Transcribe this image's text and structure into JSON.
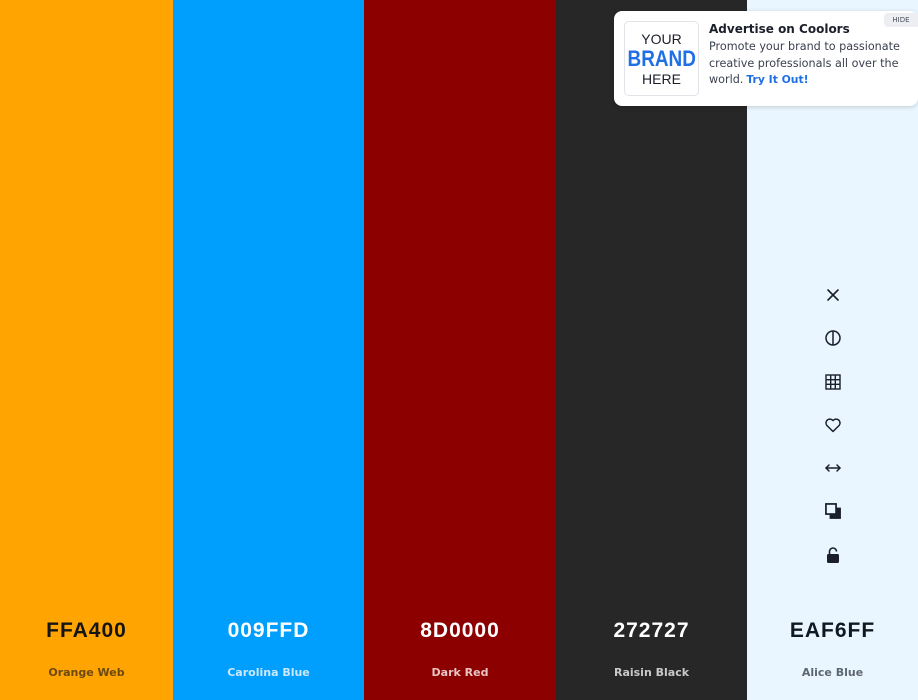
{
  "swatches": [
    {
      "hex": "FFA400",
      "name": "Orange Web",
      "bg": "#FFA400",
      "hex_color": "#151515",
      "name_color": "#6b4a12",
      "width": 173
    },
    {
      "hex": "009FFD",
      "name": "Carolina Blue",
      "bg": "#009FFD",
      "hex_color": "#ffffff",
      "name_color": "#cbe7fb",
      "width": 191
    },
    {
      "hex": "8D0000",
      "name": "Dark Red",
      "bg": "#8D0000",
      "hex_color": "#ffffff",
      "name_color": "#e7c5c5",
      "width": 192
    },
    {
      "hex": "272727",
      "name": "Raisin Black",
      "bg": "#272727",
      "hex_color": "#ffffff",
      "name_color": "#c9c9c9",
      "width": 191
    },
    {
      "hex": "EAF6FF",
      "name": "Alice Blue",
      "bg": "#EAF6FF",
      "hex_color": "#101820",
      "name_color": "#5e6770",
      "width": 171
    }
  ],
  "active_swatch_tools": [
    "close-icon",
    "contrast-icon",
    "grid-icon",
    "heart-icon",
    "drag-arrows-icon",
    "copy-icon",
    "unlock-icon"
  ],
  "ad": {
    "logo_line1": "YOUR",
    "logo_line2": "BRAND",
    "logo_line3": "HERE",
    "title": "Advertise on Coolors",
    "body": "Promote your brand to passionate creative professionals all over the world.",
    "link": "Try It Out!",
    "hide": "HIDE"
  }
}
